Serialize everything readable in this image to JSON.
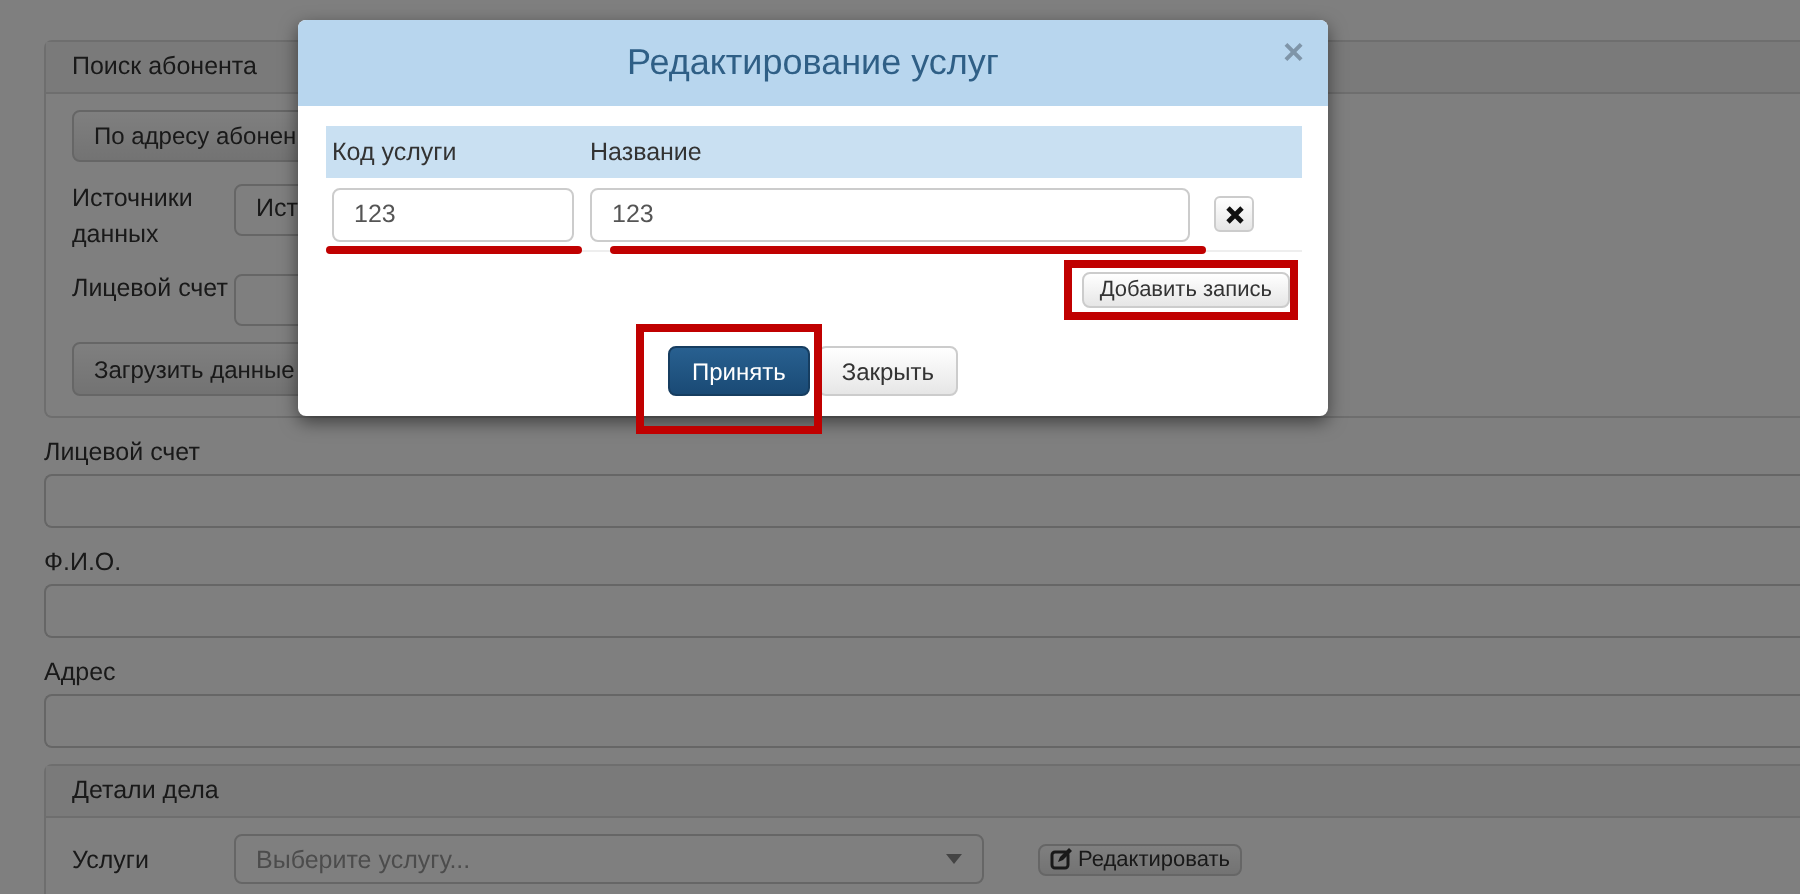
{
  "page": {
    "search_panel": {
      "title": "Поиск абонента",
      "mode_button": "По адресу абонен",
      "fields": [
        {
          "label": "Источники данных",
          "kind": "select",
          "value": "Ист"
        },
        {
          "label": "Лицевой счет",
          "kind": "input"
        }
      ],
      "load_button": "Загрузить данные"
    },
    "fields": [
      {
        "label": "Лицевой счет"
      },
      {
        "label": "Ф.И.О."
      },
      {
        "label": "Адрес"
      }
    ],
    "details_panel": {
      "title": "Детали дела",
      "services": {
        "label": "Услуги",
        "placeholder": "Выберите услугу...",
        "edit_button": "Редактировать"
      }
    }
  },
  "modal": {
    "title": "Редактирование услуг",
    "close": "×",
    "columns": [
      "Код услуги",
      "Название"
    ],
    "rows": [
      {
        "code": "123",
        "name": "123"
      }
    ],
    "add_button": "Добавить запись",
    "buttons": [
      {
        "label": "Принять",
        "kind": "primary"
      },
      {
        "label": "Закрыть",
        "kind": "default"
      }
    ]
  }
}
